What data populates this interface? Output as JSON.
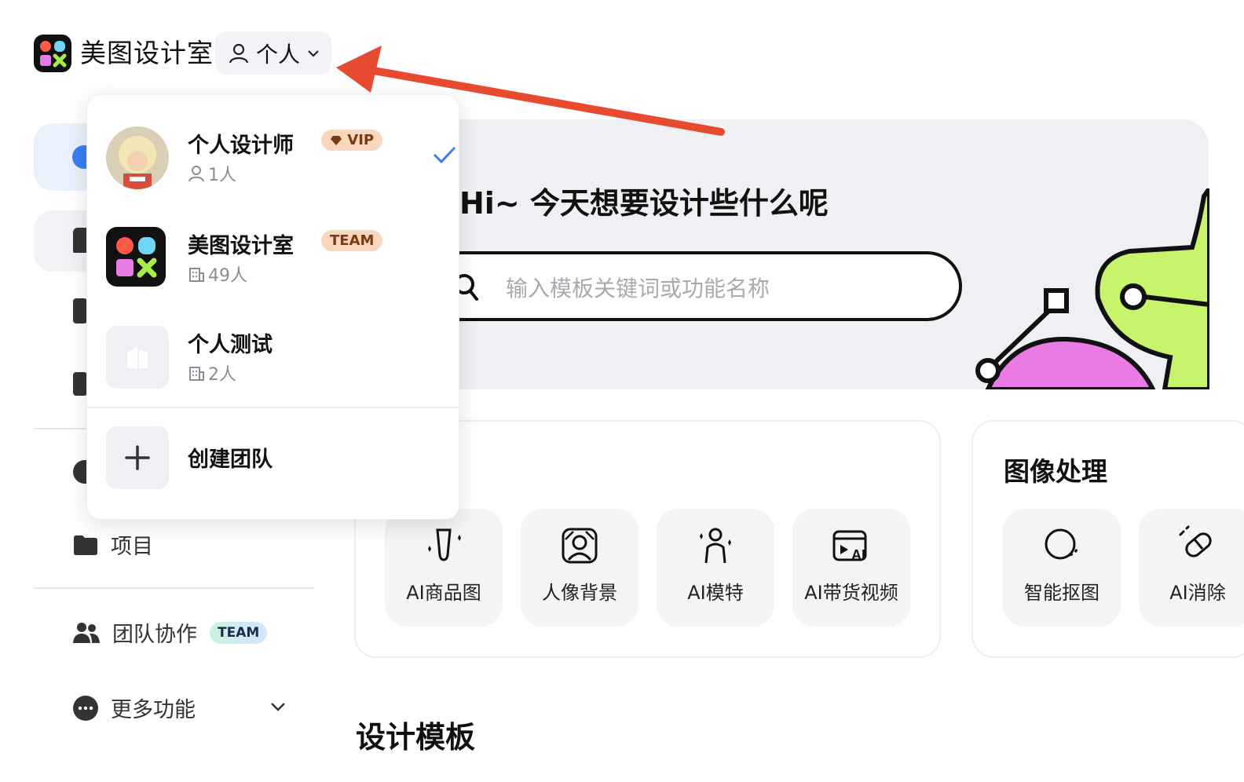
{
  "header": {
    "brand": "美图设计室",
    "workspace_label": "个人"
  },
  "sidebar": {
    "items": [
      {
        "label": "项目",
        "icon": "folder-icon"
      },
      {
        "label": "团队协作",
        "icon": "team-icon",
        "badge": "TEAM"
      },
      {
        "label": "更多功能",
        "icon": "more-icon"
      }
    ]
  },
  "banner": {
    "greeting": "Hi~ 今天想要设计些什么呢",
    "search_placeholder": "输入模板关键词或功能名称"
  },
  "cards": [
    {
      "title": "",
      "tools": [
        "AI商品图",
        "人像背景",
        "AI模特",
        "AI带货视频"
      ]
    },
    {
      "title": "图像处理",
      "tools": [
        "智能抠图",
        "AI消除"
      ]
    }
  ],
  "section_title": "设计模板",
  "dropdown": {
    "workspaces": [
      {
        "name": "个人设计师",
        "badge": "VIP",
        "count": "1人",
        "selected": true
      },
      {
        "name": "美图设计室",
        "badge": "TEAM",
        "count": "49人",
        "selected": false
      },
      {
        "name": "个人测试",
        "badge": "",
        "count": "2人",
        "selected": false
      }
    ],
    "create_label": "创建团队"
  },
  "colors": {
    "accent_blue": "#3a7ef6",
    "arrow_red": "#e84a2f",
    "badge_peach": "#f8d7bd",
    "deco_green": "#c7f46a",
    "deco_pink": "#e97ae6"
  }
}
